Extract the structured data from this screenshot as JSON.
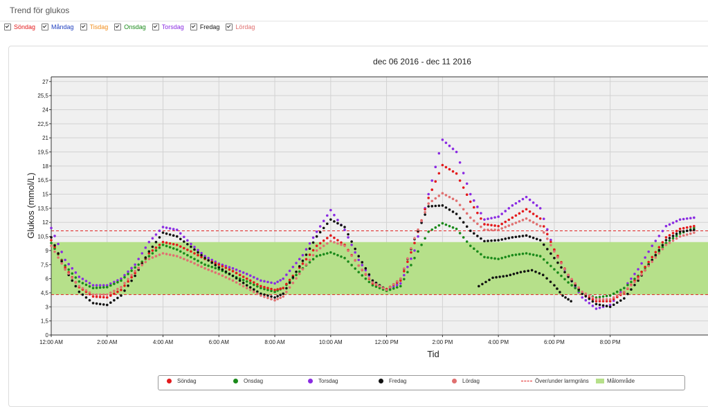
{
  "page": {
    "title": "Trend för glukos"
  },
  "day_filter": [
    {
      "label": "Söndag",
      "color": "#e31a1c",
      "checked": true
    },
    {
      "label": "Måndag",
      "color": "#1f3fbf",
      "checked": true
    },
    {
      "label": "Tisdag",
      "color": "#f28e1c",
      "checked": true
    },
    {
      "label": "Onsdag",
      "color": "#1a8a1a",
      "checked": true
    },
    {
      "label": "Torsdag",
      "color": "#8a2be2",
      "checked": true
    },
    {
      "label": "Fredag",
      "color": "#111111",
      "checked": true
    },
    {
      "label": "Lördag",
      "color": "#e07070",
      "checked": true
    }
  ],
  "legend": {
    "items": [
      {
        "label": "Söndag",
        "color": "#e31a1c",
        "kind": "dot"
      },
      {
        "label": "Onsdag",
        "color": "#1a8a1a",
        "kind": "dot"
      },
      {
        "label": "Torsdag",
        "color": "#8a2be2",
        "kind": "dot"
      },
      {
        "label": "Fredag",
        "color": "#111111",
        "kind": "dot"
      },
      {
        "label": "Lördag",
        "color": "#e07070",
        "kind": "dot"
      },
      {
        "label": "Över/under larmgräns",
        "color": "#e02020",
        "kind": "dash"
      },
      {
        "label": "Målområde",
        "color": "#b6e08a",
        "kind": "square"
      }
    ]
  },
  "chart_data": {
    "type": "scatter",
    "title": "dec 06 2016 - dec 11 2016",
    "xlabel": "Tid",
    "ylabel": "Glukos (mmol/L)",
    "xlim": [
      0,
      23.5
    ],
    "ylim": [
      0,
      27.5
    ],
    "x_ticks": [
      "12:00 AM",
      "2:00 AM",
      "4:00 AM",
      "6:00 AM",
      "8:00 AM",
      "10:00 AM",
      "12:00 PM",
      "2:00 PM",
      "4:00 PM",
      "6:00 PM",
      "8:00 PM"
    ],
    "y_ticks": [
      "0",
      "1,5",
      "3",
      "4,5",
      "6",
      "7,5",
      "9",
      "10,5",
      "12",
      "13,5",
      "15",
      "16,5",
      "18",
      "19,5",
      "21",
      "22,5",
      "24",
      "25,5",
      "27"
    ],
    "target_range": [
      4.3,
      9.9
    ],
    "alarm_limits": [
      4.3,
      11.1
    ],
    "target_color": "#b6e08a",
    "alarm_color": "#e02020",
    "grid": true,
    "legend_position": "bottom",
    "series": [
      {
        "name": "Torsdag",
        "color": "#8a2be2",
        "points": [
          [
            0,
            11.4
          ],
          [
            0.5,
            8
          ],
          [
            1,
            6.2
          ],
          [
            1.5,
            5.3
          ],
          [
            2,
            5.3
          ],
          [
            2.5,
            6
          ],
          [
            3,
            7.5
          ],
          [
            3.5,
            9.9
          ],
          [
            4,
            11.5
          ],
          [
            4.5,
            11.2
          ],
          [
            5,
            9.7
          ],
          [
            5.5,
            8.4
          ],
          [
            6,
            7.6
          ],
          [
            6.5,
            7.1
          ],
          [
            7,
            6.5
          ],
          [
            7.5,
            5.8
          ],
          [
            8,
            5.5
          ],
          [
            8.3,
            6
          ],
          [
            9,
            8.5
          ],
          [
            9.5,
            11
          ],
          [
            10,
            13.3
          ],
          [
            10.5,
            11.2
          ],
          [
            11,
            8
          ],
          [
            11.5,
            5.8
          ],
          [
            12,
            4.8
          ],
          [
            12.5,
            5.5
          ],
          [
            13,
            9
          ],
          [
            13.5,
            15
          ],
          [
            14,
            20.8
          ],
          [
            14.5,
            19.5
          ],
          [
            15,
            15
          ],
          [
            15.5,
            12.3
          ],
          [
            16,
            12.6
          ],
          [
            16.5,
            13.8
          ],
          [
            17,
            14.7
          ],
          [
            17.5,
            13.5
          ],
          [
            18,
            9
          ],
          [
            18.5,
            6.3
          ],
          [
            19,
            4
          ],
          [
            19.5,
            2.8
          ],
          [
            20,
            3.2
          ],
          [
            20.5,
            5
          ],
          [
            21,
            7
          ],
          [
            21.5,
            9.5
          ],
          [
            22,
            11.6
          ],
          [
            22.5,
            12.3
          ],
          [
            23,
            12.5
          ]
        ]
      },
      {
        "name": "Onsdag",
        "color": "#1a8a1a",
        "points": [
          [
            0,
            9.8
          ],
          [
            0.5,
            7.4
          ],
          [
            1,
            5.7
          ],
          [
            1.5,
            5
          ],
          [
            2,
            5.1
          ],
          [
            2.5,
            5.8
          ],
          [
            3,
            7.2
          ],
          [
            3.5,
            8.4
          ],
          [
            4,
            9.6
          ],
          [
            4.5,
            9.1
          ],
          [
            5,
            8.3
          ],
          [
            5.5,
            7.5
          ],
          [
            6,
            7
          ],
          [
            6.5,
            6.3
          ],
          [
            7,
            5.7
          ],
          [
            7.5,
            5
          ],
          [
            8,
            4.6
          ],
          [
            8.3,
            5
          ],
          [
            9,
            7.1
          ],
          [
            9.5,
            8.4
          ],
          [
            10,
            8.8
          ],
          [
            10.5,
            8.2
          ],
          [
            11,
            6.7
          ],
          [
            11.5,
            5.3
          ],
          [
            12,
            4.7
          ],
          [
            12.5,
            5.2
          ],
          [
            13,
            8.2
          ],
          [
            13.5,
            11
          ],
          [
            14,
            11.9
          ],
          [
            14.5,
            11.3
          ],
          [
            15,
            9.5
          ],
          [
            15.5,
            8.3
          ],
          [
            16,
            8.1
          ],
          [
            16.5,
            8.5
          ],
          [
            17,
            8.7
          ],
          [
            17.5,
            8.4
          ],
          [
            18,
            7
          ],
          [
            18.5,
            5.6
          ],
          [
            19,
            4.4
          ],
          [
            19.5,
            4
          ],
          [
            20,
            4.2
          ],
          [
            20.5,
            5
          ],
          [
            21,
            6.3
          ],
          [
            21.5,
            8
          ],
          [
            22,
            9.8
          ],
          [
            22.5,
            10.8
          ],
          [
            23,
            11.4
          ]
        ]
      },
      {
        "name": "Söndag",
        "color": "#e31a1c",
        "points": [
          [
            0,
            10.1
          ],
          [
            0.5,
            7.2
          ],
          [
            1,
            5.1
          ],
          [
            1.5,
            4.1
          ],
          [
            2,
            4
          ],
          [
            2.5,
            4.8
          ],
          [
            3,
            6.6
          ],
          [
            3.5,
            8.7
          ],
          [
            4,
            9.9
          ],
          [
            4.5,
            9.6
          ],
          [
            5,
            8.9
          ],
          [
            5.5,
            8.1
          ],
          [
            6,
            7.5
          ],
          [
            6.5,
            6.8
          ],
          [
            7,
            6
          ],
          [
            7.5,
            5.2
          ],
          [
            8,
            4.8
          ],
          [
            8.3,
            5
          ],
          [
            9,
            7.6
          ],
          [
            9.5,
            9.5
          ],
          [
            10,
            10.6
          ],
          [
            10.5,
            9.6
          ],
          [
            11,
            7.4
          ],
          [
            11.5,
            5.5
          ],
          [
            12,
            4.9
          ],
          [
            12.5,
            5.8
          ],
          [
            13,
            9.8
          ],
          [
            13.5,
            14.6
          ],
          [
            14,
            18.1
          ],
          [
            14.5,
            17.2
          ],
          [
            15,
            14.2
          ],
          [
            15.5,
            11.8
          ],
          [
            16,
            11.6
          ],
          [
            16.5,
            12.5
          ],
          [
            17,
            13.4
          ],
          [
            17.5,
            12.4
          ],
          [
            18,
            9.1
          ],
          [
            18.5,
            6.4
          ],
          [
            19,
            4.4
          ],
          [
            19.5,
            3.6
          ],
          [
            20,
            3.6
          ],
          [
            20.5,
            4.5
          ],
          [
            21,
            6.2
          ],
          [
            21.5,
            8.3
          ],
          [
            22,
            10.4
          ],
          [
            22.5,
            11.3
          ],
          [
            23,
            11.6
          ]
        ]
      },
      {
        "name": "Fredag",
        "color": "#111111",
        "points": [
          [
            0,
            10.4
          ],
          [
            0.5,
            7
          ],
          [
            1,
            4.6
          ],
          [
            1.5,
            3.4
          ],
          [
            2,
            3.2
          ],
          [
            2.5,
            4.2
          ],
          [
            3,
            6.3
          ],
          [
            3.5,
            8.9
          ],
          [
            4,
            10.9
          ],
          [
            4.5,
            10.5
          ],
          [
            5,
            9.4
          ],
          [
            5.5,
            8.2
          ],
          [
            6,
            7.2
          ],
          [
            6.5,
            6.3
          ],
          [
            7,
            5.3
          ],
          [
            7.5,
            4.4
          ],
          [
            8,
            4
          ],
          [
            8.3,
            4.4
          ],
          [
            9,
            7.9
          ],
          [
            9.5,
            10.5
          ],
          [
            10,
            12.3
          ],
          [
            10.5,
            11.5
          ],
          [
            11,
            8.4
          ],
          [
            11.5,
            5.8
          ],
          [
            12,
            4.8
          ],
          [
            12.5,
            6
          ],
          [
            13,
            10.2
          ],
          [
            13.5,
            13.7
          ],
          [
            14,
            13.8
          ],
          [
            14.5,
            12.9
          ],
          [
            15,
            11.1
          ],
          [
            15.5,
            10
          ],
          [
            16,
            10.1
          ],
          [
            16.5,
            10.4
          ],
          [
            17,
            10.6
          ],
          [
            17.5,
            10.1
          ],
          [
            18,
            8.2
          ],
          [
            18.5,
            6.2
          ],
          [
            19,
            4.4
          ],
          [
            19.5,
            3.3
          ],
          [
            20,
            3
          ],
          [
            20.5,
            3.9
          ],
          [
            21,
            5.8
          ],
          [
            21.5,
            8
          ],
          [
            22,
            10.1
          ],
          [
            22.5,
            11
          ],
          [
            23,
            11.2
          ]
        ]
      },
      {
        "name": "Lördag",
        "color": "#e07070",
        "points": [
          [
            0,
            9.5
          ],
          [
            0.5,
            7
          ],
          [
            1,
            5.2
          ],
          [
            1.5,
            4.3
          ],
          [
            2,
            4.3
          ],
          [
            2.5,
            5.1
          ],
          [
            3,
            6.8
          ],
          [
            3.5,
            8.1
          ],
          [
            4,
            8.7
          ],
          [
            4.5,
            8.4
          ],
          [
            5,
            7.8
          ],
          [
            5.5,
            7.1
          ],
          [
            6,
            6.5
          ],
          [
            6.5,
            5.8
          ],
          [
            7,
            5
          ],
          [
            7.5,
            4.2
          ],
          [
            8,
            3.7
          ],
          [
            8.3,
            4.1
          ],
          [
            9,
            7
          ],
          [
            9.5,
            9
          ],
          [
            10,
            10
          ],
          [
            10.5,
            9.5
          ],
          [
            11,
            7.4
          ],
          [
            11.5,
            5.6
          ],
          [
            12,
            4.8
          ],
          [
            12.5,
            6
          ],
          [
            13,
            10.3
          ],
          [
            13.5,
            14
          ],
          [
            14,
            15.1
          ],
          [
            14.5,
            14.3
          ],
          [
            15,
            12.5
          ],
          [
            15.5,
            11.2
          ],
          [
            16,
            11.2
          ],
          [
            16.5,
            11.8
          ],
          [
            17,
            12.4
          ],
          [
            17.5,
            11.6
          ],
          [
            18,
            8.9
          ],
          [
            18.5,
            6.4
          ],
          [
            19,
            4.6
          ],
          [
            19.5,
            3.8
          ],
          [
            20,
            3.8
          ],
          [
            20.5,
            4.6
          ],
          [
            21,
            6
          ],
          [
            21.5,
            7.8
          ],
          [
            22,
            9.6
          ],
          [
            22.5,
            10.5
          ],
          [
            23,
            10.9
          ]
        ]
      },
      {
        "name": "Fredag",
        "color": "#111111",
        "points": [
          [
            15.3,
            5.2
          ],
          [
            15.8,
            6.1
          ],
          [
            16.3,
            6.3
          ],
          [
            16.8,
            6.7
          ],
          [
            17.2,
            6.9
          ],
          [
            17.6,
            6.4
          ],
          [
            18,
            5.3
          ],
          [
            18.3,
            4.2
          ],
          [
            18.6,
            3.6
          ]
        ]
      }
    ]
  }
}
